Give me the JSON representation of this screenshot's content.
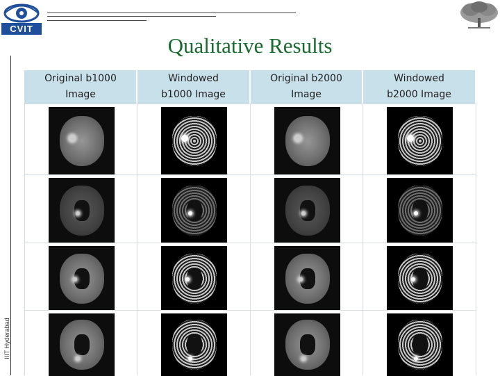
{
  "header": {
    "logo_text": "CVIT",
    "title": "Qualitative Results",
    "sidebar_text": "IIIT Hyderabad"
  },
  "columns": [
    {
      "label": "Original b1000 Image"
    },
    {
      "label": "Windowed b1000 Image"
    },
    {
      "label": "Original b2000 Image"
    },
    {
      "label": "Windowed b2000 Image"
    }
  ],
  "rows": [
    {
      "scans": [
        "original",
        "windowed",
        "original",
        "windowed"
      ],
      "lesion": "left-large"
    },
    {
      "scans": [
        "original",
        "windowed",
        "original",
        "windowed"
      ],
      "lesion": "center-small"
    },
    {
      "scans": [
        "original",
        "windowed",
        "original",
        "windowed"
      ],
      "lesion": "left-mid"
    },
    {
      "scans": [
        "original",
        "windowed",
        "original",
        "windowed"
      ],
      "lesion": "left-lower"
    }
  ],
  "colors": {
    "title": "#1a6b2e",
    "header_bg": "#c7e0ea",
    "logo_bg": "#1f4e9a"
  }
}
